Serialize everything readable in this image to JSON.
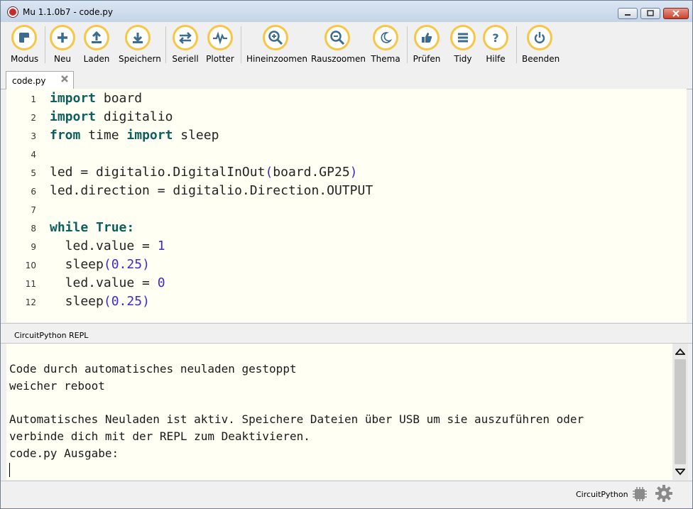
{
  "window": {
    "title": "Mu 1.1.0b7 - code.py"
  },
  "toolbar": {
    "buttons": [
      {
        "label": "Modus",
        "icon": "mode-icon"
      },
      {
        "label": "Neu",
        "icon": "plus-icon"
      },
      {
        "label": "Laden",
        "icon": "upload-icon"
      },
      {
        "label": "Speichern",
        "icon": "download-icon"
      },
      {
        "label": "Seriell",
        "icon": "arrows-icon"
      },
      {
        "label": "Plotter",
        "icon": "pulse-icon"
      },
      {
        "label": "Hineinzoomen",
        "icon": "zoom-in-icon"
      },
      {
        "label": "Rauszoomen",
        "icon": "zoom-out-icon"
      },
      {
        "label": "Thema",
        "icon": "moon-icon"
      },
      {
        "label": "Prüfen",
        "icon": "thumbs-up-icon"
      },
      {
        "label": "Tidy",
        "icon": "lines-icon"
      },
      {
        "label": "Hilfe",
        "icon": "help-icon"
      },
      {
        "label": "Beenden",
        "icon": "power-icon"
      }
    ]
  },
  "tabs": [
    {
      "label": "code.py"
    }
  ],
  "editor": {
    "line_numbers": [
      "1",
      "2",
      "3",
      "4",
      "5",
      "6",
      "7",
      "8",
      "9",
      "10",
      "11",
      "12"
    ],
    "code": {
      "l1": [
        "import",
        " board"
      ],
      "l2": [
        "import",
        " digitalio"
      ],
      "l3": [
        "from",
        " time ",
        "import",
        " sleep"
      ],
      "l5": [
        "led = digitalio.DigitalInOut",
        "(",
        "board.GP25",
        ")"
      ],
      "l6": [
        "led.direction = digitalio.Direction.OUTPUT"
      ],
      "l8": [
        "while",
        " ",
        "True",
        ":"
      ],
      "l9": [
        "  led.value = ",
        "1"
      ],
      "l10": [
        "  sleep",
        "(",
        "0.25",
        ")"
      ],
      "l11": [
        "  led.value = ",
        "0"
      ],
      "l12": [
        "  sleep",
        "(",
        "0.25",
        ")"
      ]
    }
  },
  "repl": {
    "label": "CircuitPython REPL",
    "lines": [
      "Code durch automatisches neuladen gestoppt",
      "weicher reboot",
      "Automatisches Neuladen ist aktiv. Speichere Dateien über USB um sie auszuführen oder",
      "verbinde dich mit der REPL zum Deaktivieren.",
      "code.py Ausgabe:"
    ]
  },
  "statusbar": {
    "mode": "CircuitPython"
  },
  "colors": {
    "accent": "#f6c744",
    "keyword": "#0c5f5c",
    "number": "#3c2bd3",
    "editor_bg": "#fffff4"
  }
}
